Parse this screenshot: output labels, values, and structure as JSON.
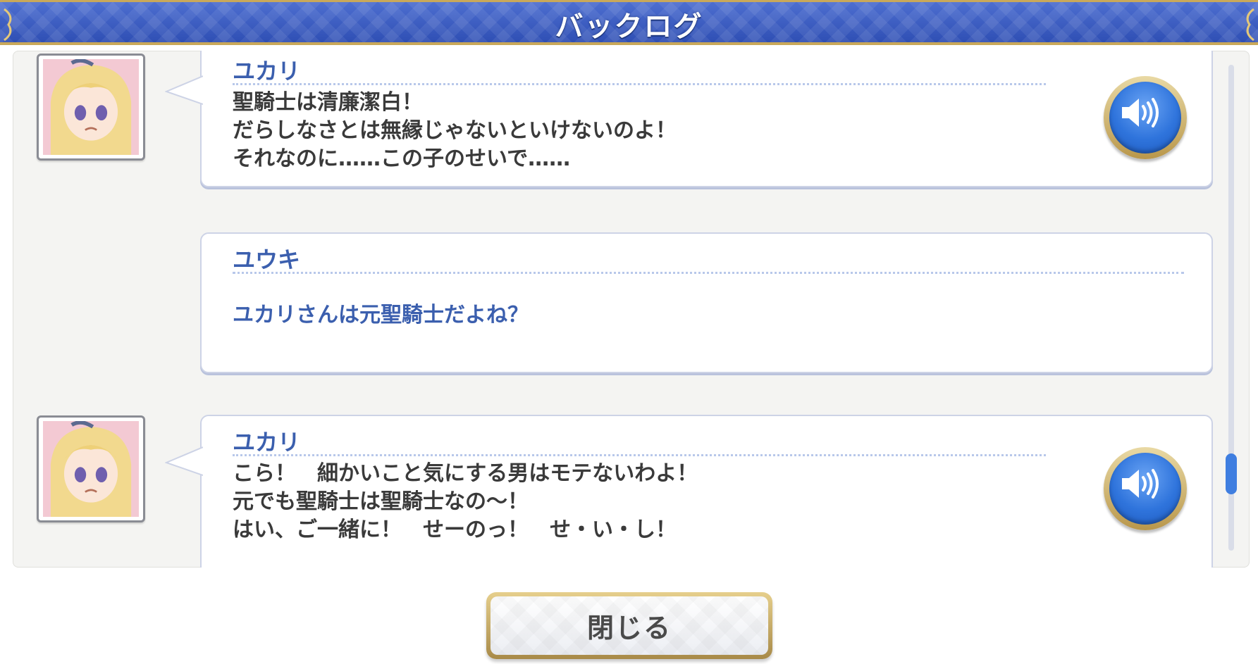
{
  "header": {
    "title": "バックログ"
  },
  "entries": [
    {
      "speaker": "ユカリ",
      "lines": [
        "聖騎士は清廉潔白！",
        "だらしなさとは無縁じゃないといけないのよ！",
        "それなのに……この子のせいで……"
      ],
      "has_avatar": true,
      "has_voice": true,
      "voice_icon": "speaker-icon"
    },
    {
      "speaker": "ユウキ",
      "lines": [
        "ユカリさんは元聖騎士だよね？"
      ],
      "has_avatar": false,
      "has_voice": false
    },
    {
      "speaker": "ユカリ",
      "lines": [
        "こら！　細かいこと気にする男はモテないわよ！",
        "元でも聖騎士は聖騎士なの～！",
        "はい、ご一緒に！　せーのっ！　せ・い・し！"
      ],
      "has_avatar": true,
      "has_voice": true,
      "voice_icon": "speaker-icon"
    }
  ],
  "close_button": {
    "label": "閉じる"
  },
  "colors": {
    "header_blue": "#3d5ec3",
    "gold_trim": "#c9a85a",
    "speaker_name": "#3b5fae",
    "voice_button": "#2f74dc",
    "scroll_thumb": "#3f7ee0"
  }
}
